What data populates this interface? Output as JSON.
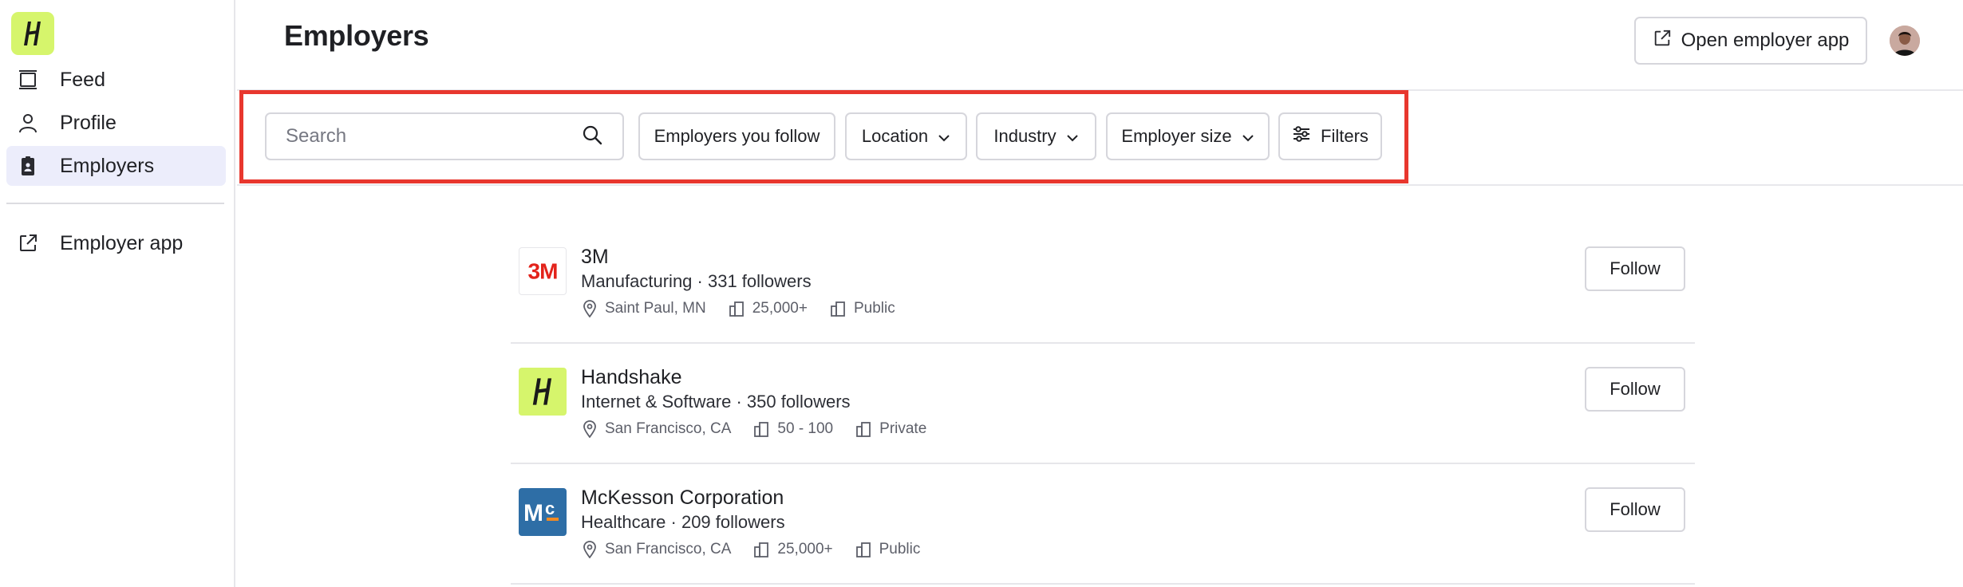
{
  "sidebar": {
    "items": [
      {
        "label": "Feed",
        "icon": "feed-icon"
      },
      {
        "label": "Profile",
        "icon": "profile-icon"
      },
      {
        "label": "Employers",
        "icon": "employers-icon",
        "active": true
      },
      {
        "label": "Employer app",
        "icon": "external-link-icon"
      }
    ]
  },
  "header": {
    "title": "Employers",
    "open_app_label": "Open employer app"
  },
  "filters": {
    "search_placeholder": "Search",
    "following_label": "Employers you follow",
    "location_label": "Location",
    "industry_label": "Industry",
    "size_label": "Employer size",
    "more_label": "Filters"
  },
  "employers": [
    {
      "name": "3M",
      "industry": "Manufacturing",
      "followers": "331 followers",
      "location": "Saint Paul, MN",
      "size": "25,000+",
      "type": "Public",
      "follow_label": "Follow"
    },
    {
      "name": "Handshake",
      "industry": "Internet & Software",
      "followers": "350 followers",
      "location": "San Francisco, CA",
      "size": "50 - 100",
      "type": "Private",
      "follow_label": "Follow"
    },
    {
      "name": "McKesson Corporation",
      "industry": "Healthcare",
      "followers": "209 followers",
      "location": "San Francisco, CA",
      "size": "25,000+",
      "type": "Public",
      "follow_label": "Follow"
    }
  ],
  "colors": {
    "brand_lime": "#d6f56c",
    "highlight_red": "#e8372e",
    "active_nav_bg": "#ecedfb",
    "logo_3m_red": "#e3231b",
    "logo_mckesson_blue": "#2e6ea6",
    "logo_mckesson_orange": "#f08a24"
  }
}
